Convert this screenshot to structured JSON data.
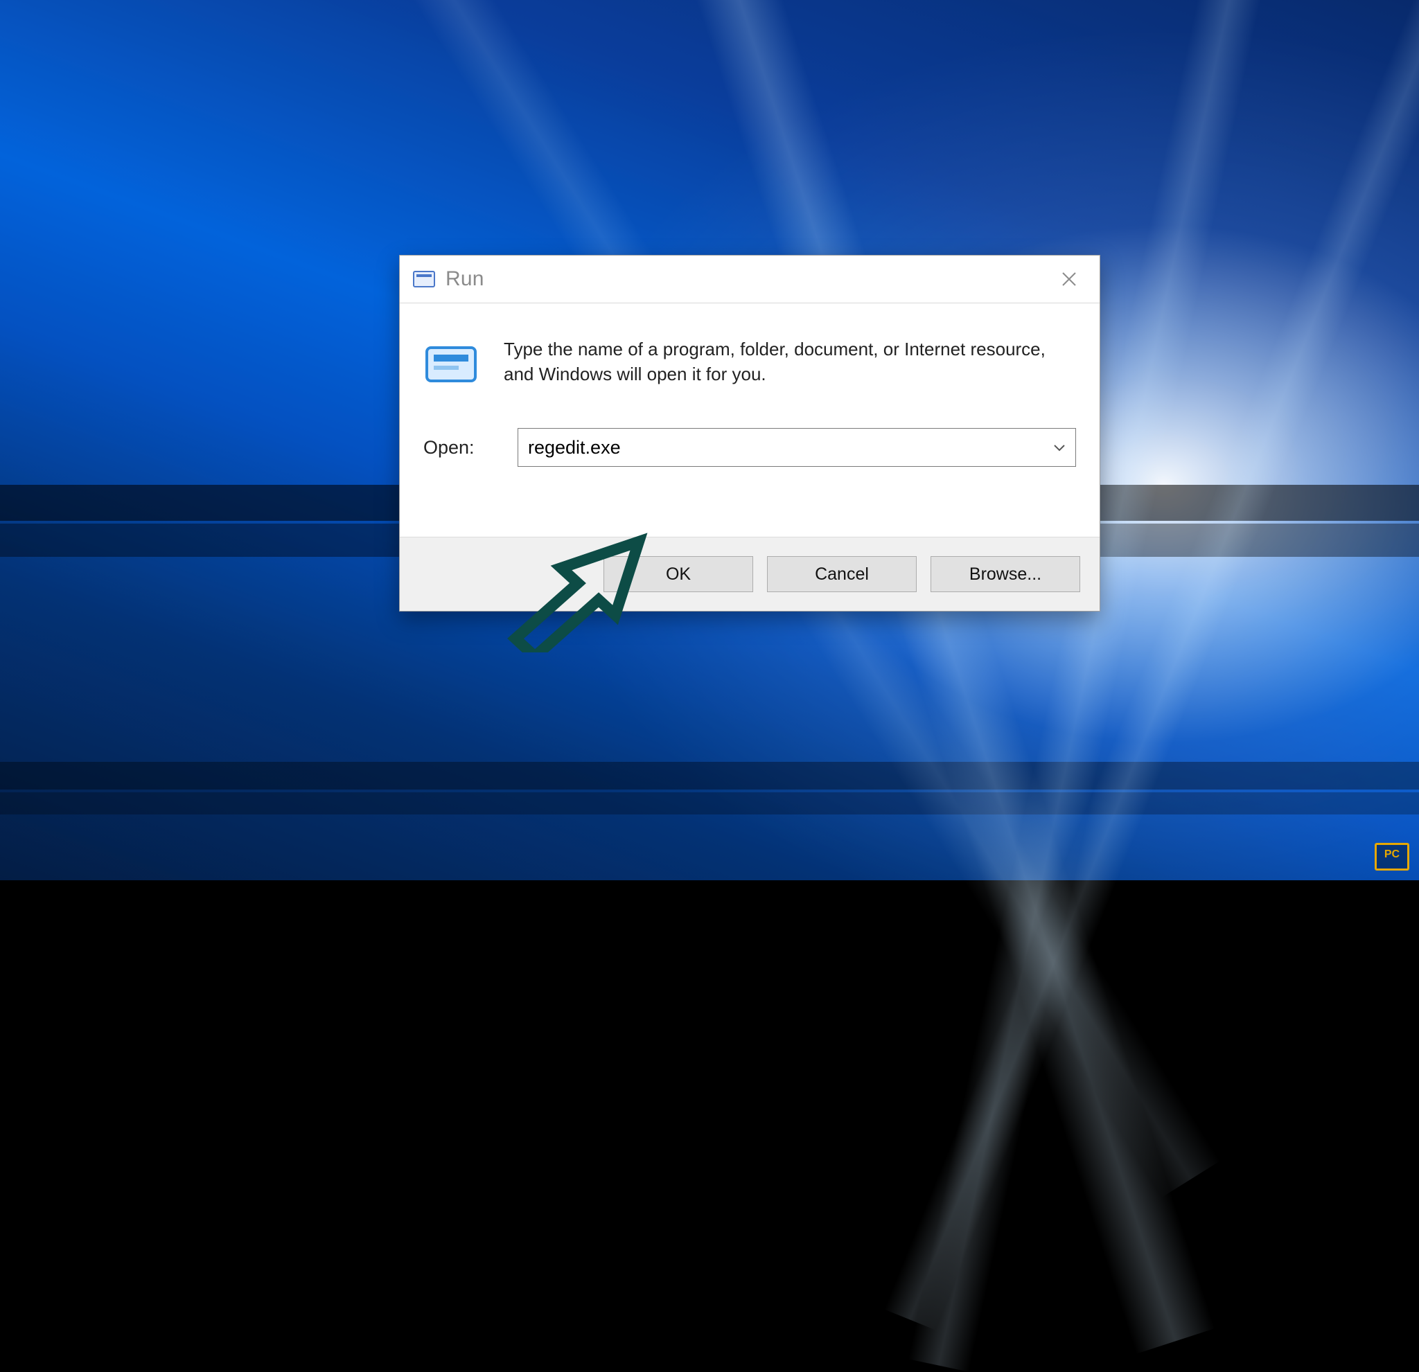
{
  "dialog": {
    "title": "Run",
    "description": "Type the name of a program, folder, document, or Internet resource, and Windows will open it for you.",
    "open_label": "Open:",
    "open_value": "regedit.exe",
    "buttons": {
      "ok": "OK",
      "cancel": "Cancel",
      "browse": "Browse..."
    }
  },
  "badge": {
    "text": "PC"
  },
  "icons": {
    "app": "run-icon",
    "close": "close-icon",
    "dropdown": "chevron-down-icon",
    "runlogo": "run-dialog-icon"
  }
}
